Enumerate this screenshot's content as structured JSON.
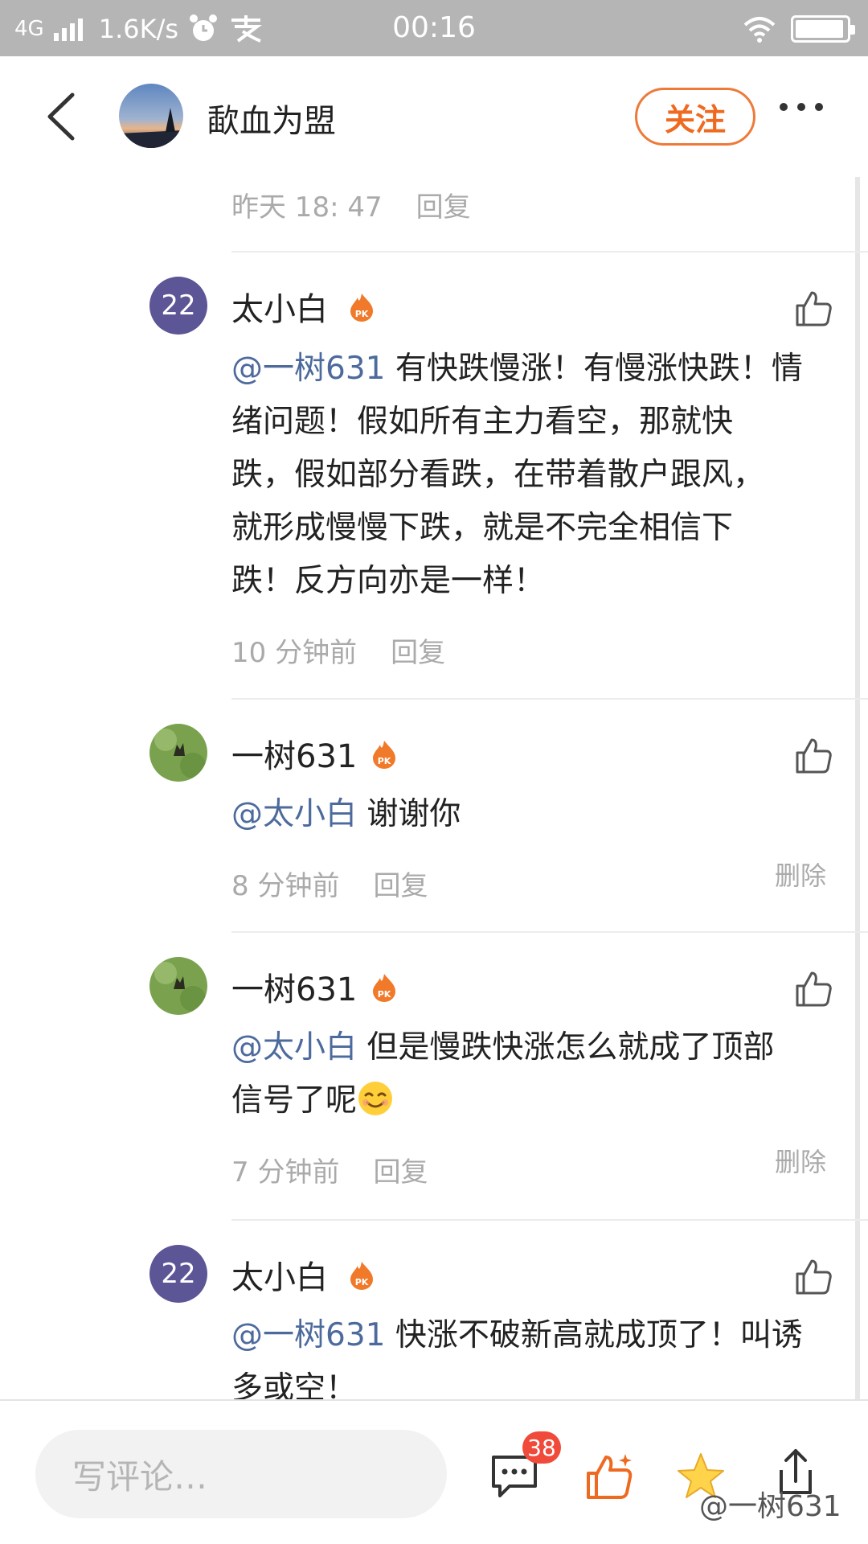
{
  "status_bar": {
    "network": "4G",
    "speed": "1.6K/s",
    "time": "00:16",
    "battery_level": 0.95
  },
  "header": {
    "title": "歃血为盟",
    "follow_label": "关注"
  },
  "top_meta": {
    "time": "昨天 18: 47",
    "reply": "回复"
  },
  "comments": [
    {
      "avatar_text": "22",
      "name": "太小白",
      "mention": "@一树631",
      "lines": [
        "有快跌慢涨！有慢涨快跌！情",
        "绪问题！假如所有主力看空，那就快",
        "跌，假如部分看跌，在带着散户跟风，",
        "就形成慢慢下跌，就是不完全相信下",
        "跌！反方向亦是一样！"
      ],
      "time": "10 分钟前",
      "reply": "回复"
    },
    {
      "name": "一树631",
      "mention": "@太小白",
      "text": "谢谢你",
      "time": "8 分钟前",
      "reply": "回复",
      "delete": "删除"
    },
    {
      "name": "一树631",
      "mention": "@太小白",
      "line1": "但是慢跌快涨怎么就成了顶部",
      "line2": "信号了呢",
      "time": "7 分钟前",
      "reply": "回复",
      "delete": "删除"
    },
    {
      "avatar_text": "22",
      "name": "太小白",
      "mention": "@一树631",
      "line1": "快涨不破新高就成顶了！叫诱",
      "line2": "多或空！"
    }
  ],
  "bottom_bar": {
    "placeholder": "写评论…",
    "comment_count": "38",
    "watermark": "@一树631"
  },
  "colors": {
    "accent": "#ee6a20",
    "mention": "#4d6a9d",
    "avatar_purple": "#5c5596",
    "badge_red": "#f04a3a"
  },
  "icons": [
    "back-icon",
    "more-icon",
    "pk-badge-icon",
    "like-icon",
    "comment-icon",
    "thumb-up-icon",
    "star-icon",
    "share-icon"
  ]
}
